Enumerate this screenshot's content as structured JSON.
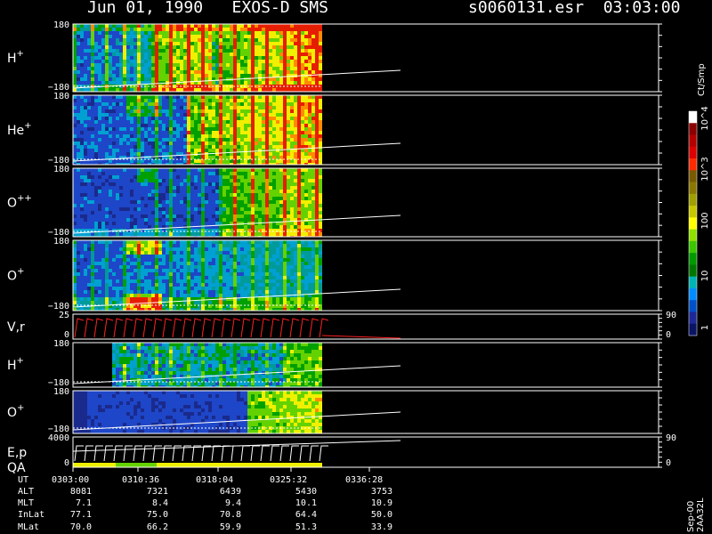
{
  "header": {
    "date_instrument": "Jun 01, 1990   EXOS-D SMS",
    "file_time": "s0060131.esr  03:03:00"
  },
  "colorbar": {
    "unit_label": "Ct/Smp",
    "tick_labels": [
      "10^4",
      "10^3",
      "100",
      "10",
      "1"
    ],
    "colors": [
      "#ffffff",
      "#8b0000",
      "#b40000",
      "#dc0000",
      "#ff2a00",
      "#7a5a00",
      "#8c7800",
      "#a0a000",
      "#c8c800",
      "#ffff00",
      "#90e000",
      "#3cc800",
      "#009a00",
      "#007800",
      "#00b4b4",
      "#008cff",
      "#0050c8",
      "#1e2896",
      "#0a1464"
    ]
  },
  "chart_data": {
    "type": "heatmap",
    "title": "Jun 01, 1990   EXOS-D SMS",
    "panels": [
      {
        "label": "H",
        "superscript": "+",
        "ymax": "180",
        "ymin": "−180"
      },
      {
        "label": "He",
        "superscript": "+",
        "ymax": "180",
        "ymin": "−180"
      },
      {
        "label": "O",
        "superscript": "++",
        "ymax": "180",
        "ymin": "−180"
      },
      {
        "label": "O",
        "superscript": "+",
        "ymax": "180",
        "ymin": "−180"
      },
      {
        "label": "V,r",
        "superscript": "",
        "ymax": "25",
        "ymin": "0",
        "right_top": "90",
        "right_bottom": "0"
      },
      {
        "label": "H",
        "superscript": "+",
        "ymax": "180",
        "ymin": "−180"
      },
      {
        "label": "O",
        "superscript": "+",
        "ymax": "180",
        "ymin": "−180"
      },
      {
        "label": "E,p",
        "label2": "QA",
        "superscript": "",
        "ymax": "4000",
        "ymin": "0",
        "right_top": "90",
        "right_bottom": "0"
      }
    ],
    "x_ticks": {
      "UT": [
        "0303:00",
        "0310:36",
        "0318:04",
        "0325:32",
        "0336:28"
      ],
      "ALT": [
        "8081",
        "7321",
        "6439",
        "5430",
        "3753"
      ],
      "MLT": [
        "7.1",
        "8.4",
        "9.4",
        "10.1",
        "10.9"
      ],
      "InLat": [
        "77.1",
        "75.0",
        "70.8",
        "64.4",
        "50.0"
      ],
      "MLat": [
        "70.0",
        "66.2",
        "59.9",
        "51.3",
        "33.9"
      ]
    },
    "row_labels": [
      "UT",
      "ALT",
      "MLT",
      "InLat",
      "MLat"
    ]
  },
  "footer": {
    "version": "Sep-00 2AA32L"
  }
}
